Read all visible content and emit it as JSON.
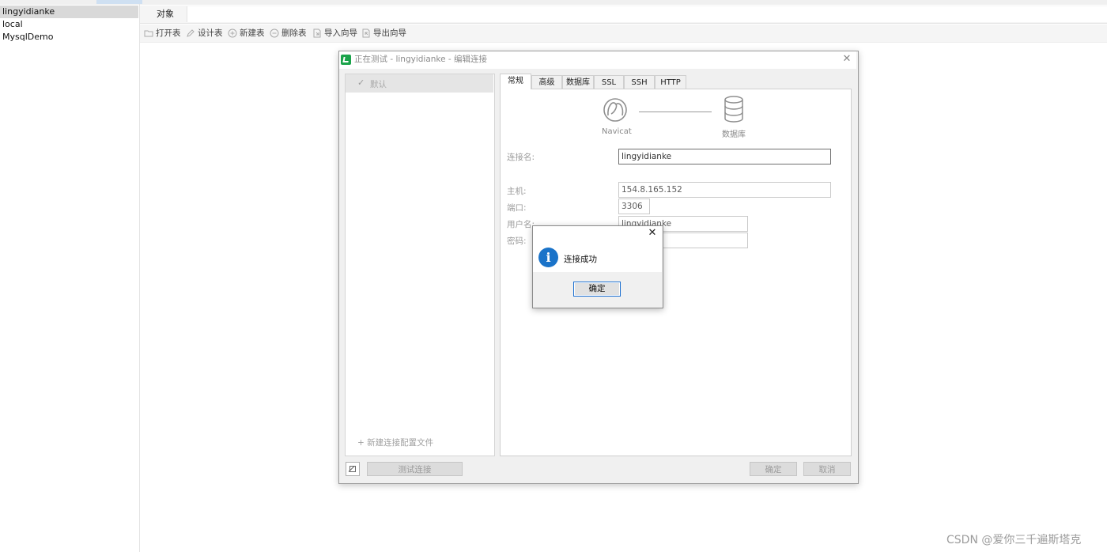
{
  "sidebar": {
    "connections": [
      "lingyidianke",
      "local",
      "MysqlDemo"
    ],
    "selected": "lingyidianke"
  },
  "object_tab": {
    "label": "对象"
  },
  "toolbar": {
    "items": [
      {
        "label": "打开表",
        "icon": "folder-open-icon"
      },
      {
        "label": "设计表",
        "icon": "pencil-icon"
      },
      {
        "label": "新建表",
        "icon": "plus-circle-icon"
      },
      {
        "label": "删除表",
        "icon": "minus-circle-icon"
      },
      {
        "label": "导入向导",
        "icon": "import-icon"
      },
      {
        "label": "导出向导",
        "icon": "export-icon"
      }
    ]
  },
  "dialog": {
    "title": "正在测试 - lingyidianke - 编辑连接",
    "profile_default": "默认",
    "new_profile": "+ 新建连接配置文件",
    "tabs": [
      "常规",
      "高级",
      "数据库",
      "SSL",
      "SSH",
      "HTTP"
    ],
    "active_tab": "常规",
    "navicat_label": "Navicat",
    "database_label": "数据库",
    "fields": {
      "connection_name": {
        "label": "连接名:",
        "value": "lingyidianke"
      },
      "host": {
        "label": "主机:",
        "value": "154.8.165.152"
      },
      "port": {
        "label": "端口:",
        "value": "3306"
      },
      "username": {
        "label": "用户名:",
        "value": "lingyidianke"
      },
      "password": {
        "label": "密码:",
        "value": ""
      }
    },
    "test_button": "测试连接",
    "ok_button": "确定",
    "cancel_button": "取消"
  },
  "message_box": {
    "text": "连接成功",
    "ok_button": "确定",
    "icon": "info-icon"
  },
  "watermark": "CSDN @爱你三千遍斯塔克",
  "colors": {
    "accent": "#1a73c9",
    "logo_green": "#1aa34a",
    "selected_row": "#d9d9d9"
  }
}
